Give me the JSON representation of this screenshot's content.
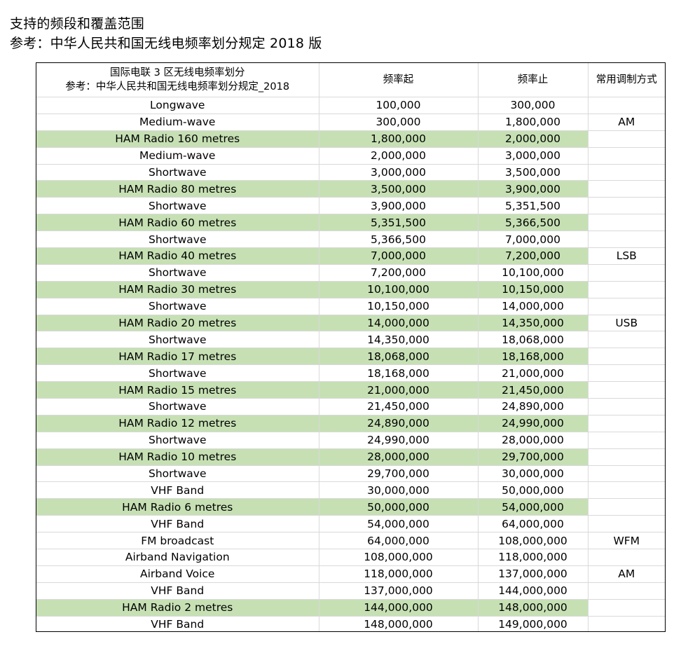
{
  "heading": {
    "line1": "支持的频段和覆盖范围",
    "line2": "参考：中华人民共和国无线电频率划分规定  2018 版"
  },
  "table": {
    "header": {
      "band_line1": "国际电联 3 区无线电频率划分",
      "band_line2": "参考：中华人民共和国无线电频率划分规定_2018",
      "start": "频率起",
      "end": "频率止",
      "mode": "常用调制方式"
    },
    "colors": {
      "ham_highlight": "#c6e0b4",
      "grid": "#d9d9d9",
      "border": "#000000"
    },
    "rows": [
      {
        "name": "Longwave",
        "start": "100,000",
        "end": "300,000",
        "mode": "",
        "ham": false
      },
      {
        "name": "Medium-wave",
        "start": "300,000",
        "end": "1,800,000",
        "mode": "AM",
        "ham": false
      },
      {
        "name": "HAM Radio 160 metres",
        "start": "1,800,000",
        "end": "2,000,000",
        "mode": "",
        "ham": true
      },
      {
        "name": "Medium-wave",
        "start": "2,000,000",
        "end": "3,000,000",
        "mode": "",
        "ham": false
      },
      {
        "name": "Shortwave",
        "start": "3,000,000",
        "end": "3,500,000",
        "mode": "",
        "ham": false
      },
      {
        "name": "HAM Radio 80 metres",
        "start": "3,500,000",
        "end": "3,900,000",
        "mode": "",
        "ham": true
      },
      {
        "name": "Shortwave",
        "start": "3,900,000",
        "end": "5,351,500",
        "mode": "",
        "ham": false
      },
      {
        "name": "HAM Radio 60 metres",
        "start": "5,351,500",
        "end": "5,366,500",
        "mode": "",
        "ham": true
      },
      {
        "name": "Shortwave",
        "start": "5,366,500",
        "end": "7,000,000",
        "mode": "",
        "ham": false
      },
      {
        "name": "HAM Radio 40 metres",
        "start": "7,000,000",
        "end": "7,200,000",
        "mode": "LSB",
        "ham": true
      },
      {
        "name": "Shortwave",
        "start": "7,200,000",
        "end": "10,100,000",
        "mode": "",
        "ham": false
      },
      {
        "name": "HAM Radio 30 metres",
        "start": "10,100,000",
        "end": "10,150,000",
        "mode": "",
        "ham": true
      },
      {
        "name": "Shortwave",
        "start": "10,150,000",
        "end": "14,000,000",
        "mode": "",
        "ham": false
      },
      {
        "name": "HAM Radio 20 metres",
        "start": "14,000,000",
        "end": "14,350,000",
        "mode": "USB",
        "ham": true
      },
      {
        "name": "Shortwave",
        "start": "14,350,000",
        "end": "18,068,000",
        "mode": "",
        "ham": false
      },
      {
        "name": "HAM Radio 17 metres",
        "start": "18,068,000",
        "end": "18,168,000",
        "mode": "",
        "ham": true
      },
      {
        "name": "Shortwave",
        "start": "18,168,000",
        "end": "21,000,000",
        "mode": "",
        "ham": false
      },
      {
        "name": "HAM Radio 15 metres",
        "start": "21,000,000",
        "end": "21,450,000",
        "mode": "",
        "ham": true
      },
      {
        "name": "Shortwave",
        "start": "21,450,000",
        "end": "24,890,000",
        "mode": "",
        "ham": false
      },
      {
        "name": "HAM Radio 12 metres",
        "start": "24,890,000",
        "end": "24,990,000",
        "mode": "",
        "ham": true
      },
      {
        "name": "Shortwave",
        "start": "24,990,000",
        "end": "28,000,000",
        "mode": "",
        "ham": false
      },
      {
        "name": "HAM Radio 10 metres",
        "start": "28,000,000",
        "end": "29,700,000",
        "mode": "",
        "ham": true
      },
      {
        "name": "Shortwave",
        "start": "29,700,000",
        "end": "30,000,000",
        "mode": "",
        "ham": false
      },
      {
        "name": "VHF Band",
        "start": "30,000,000",
        "end": "50,000,000",
        "mode": "",
        "ham": false
      },
      {
        "name": "HAM Radio 6 metres",
        "start": "50,000,000",
        "end": "54,000,000",
        "mode": "",
        "ham": true
      },
      {
        "name": "VHF Band",
        "start": "54,000,000",
        "end": "64,000,000",
        "mode": "",
        "ham": false
      },
      {
        "name": "FM broadcast",
        "start": "64,000,000",
        "end": "108,000,000",
        "mode": "WFM",
        "ham": false
      },
      {
        "name": "Airband Navigation",
        "start": "108,000,000",
        "end": "118,000,000",
        "mode": "",
        "ham": false
      },
      {
        "name": "Airband Voice",
        "start": "118,000,000",
        "end": "137,000,000",
        "mode": "AM",
        "ham": false
      },
      {
        "name": "VHF Band",
        "start": "137,000,000",
        "end": "144,000,000",
        "mode": "",
        "ham": false
      },
      {
        "name": "HAM Radio 2 metres",
        "start": "144,000,000",
        "end": "148,000,000",
        "mode": "",
        "ham": true
      },
      {
        "name": "VHF Band",
        "start": "148,000,000",
        "end": "149,000,000",
        "mode": "",
        "ham": false
      }
    ]
  }
}
